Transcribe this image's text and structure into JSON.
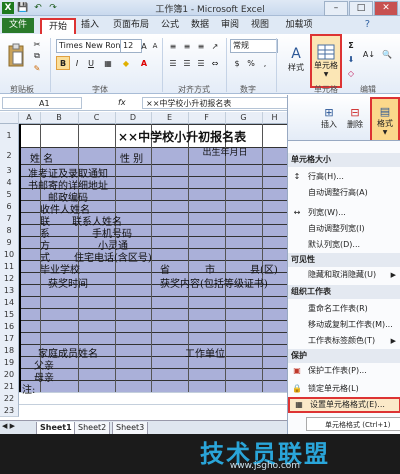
{
  "window": {
    "title": "工作簿1 - Microsoft Excel",
    "minimize": "–",
    "maximize": "□",
    "close": "✕"
  },
  "qat": {
    "save": "💾",
    "undo": "↶",
    "redo": "↷"
  },
  "tabs": [
    {
      "label": "文件"
    },
    {
      "label": "开始"
    },
    {
      "label": "插入"
    },
    {
      "label": "页面布局"
    },
    {
      "label": "公式"
    },
    {
      "label": "数据"
    },
    {
      "label": "审阅"
    },
    {
      "label": "视图"
    },
    {
      "label": "加载项"
    }
  ],
  "ribbon": {
    "font_name": "Times New Ron",
    "font_size": "12",
    "number_format": "常规",
    "groups": {
      "clipboard": "剪贴板",
      "font": "字体",
      "alignment": "对齐方式",
      "number": "数字",
      "cells": "单元格",
      "edit": "编辑"
    },
    "cells_button": "单元格",
    "style_button": "样式",
    "percent": "%",
    "comma": ","
  },
  "formula_bar": {
    "name_box": "A1",
    "fx": "fx",
    "formula": "××中学校小升初报名表"
  },
  "columns": [
    "A",
    "B",
    "C",
    "D",
    "E",
    "F",
    "G",
    "H"
  ],
  "rows": [
    "1",
    "2",
    "3",
    "4",
    "5",
    "6",
    "7",
    "8",
    "9",
    "10",
    "11",
    "12",
    "13",
    "14",
    "15",
    "16",
    "17",
    "18",
    "19",
    "20",
    "21",
    "22",
    "23"
  ],
  "sheet": {
    "title": "××中学校小升初报名表",
    "r2_name": "姓  名",
    "r2_gender": "性  别",
    "r2_birth": "出生年月日",
    "r3": "准考证及录取通知",
    "r4": "书邮寄的详细地址",
    "r5": "邮政编码",
    "r6": "收件人姓名",
    "r7a": "联",
    "r7b": "联系人姓名",
    "r8a": "系",
    "r8b": "手机号码",
    "r9a": "方",
    "r9b": "小灵通",
    "r10a": "式",
    "r10b": "住宅电话(含区号)",
    "r11a": "毕业学校",
    "r11b": "省",
    "r11c": "市",
    "r11d": "县(区)",
    "r12a": "获奖时间",
    "r12b": "获奖内容(包括等级证书)",
    "r18a": "家庭成员姓名",
    "r18b": "工作单位",
    "r19": "父亲",
    "r20": "母亲",
    "r21": "注:"
  },
  "sheet_tabs": [
    "Sheet1",
    "Sheet2",
    "Sheet3"
  ],
  "cells_panel": {
    "insert": "插入",
    "delete": "删除",
    "format": "格式"
  },
  "format_menu": {
    "section_size": "单元格大小",
    "row_height": "行高(H)...",
    "autofit_row": "自动调整行高(A)",
    "col_width": "列宽(W)...",
    "autofit_col": "自动调整列宽(I)",
    "default_width": "默认列宽(D)...",
    "section_visibility": "可见性",
    "hide_unhide": "隐藏和取消隐藏(U)",
    "section_organize": "组织工作表",
    "rename": "重命名工作表(R)",
    "move_copy": "移动或复制工作表(M)...",
    "tab_color": "工作表标签颜色(T)",
    "section_protect": "保护",
    "protect_sheet": "保护工作表(P)...",
    "lock_cell": "锁定单元格(L)",
    "format_cells": "设置单元格格式(E)...",
    "shortcut_hint": "单元格格式 (Ctrl+1)"
  },
  "watermark": {
    "line1": "技术员联盟",
    "line2": "www.jsgho.com"
  },
  "colors": {
    "accent_red": "#dd3333",
    "shade": "#aab0d9",
    "file_tab": "#2a7a2a"
  }
}
